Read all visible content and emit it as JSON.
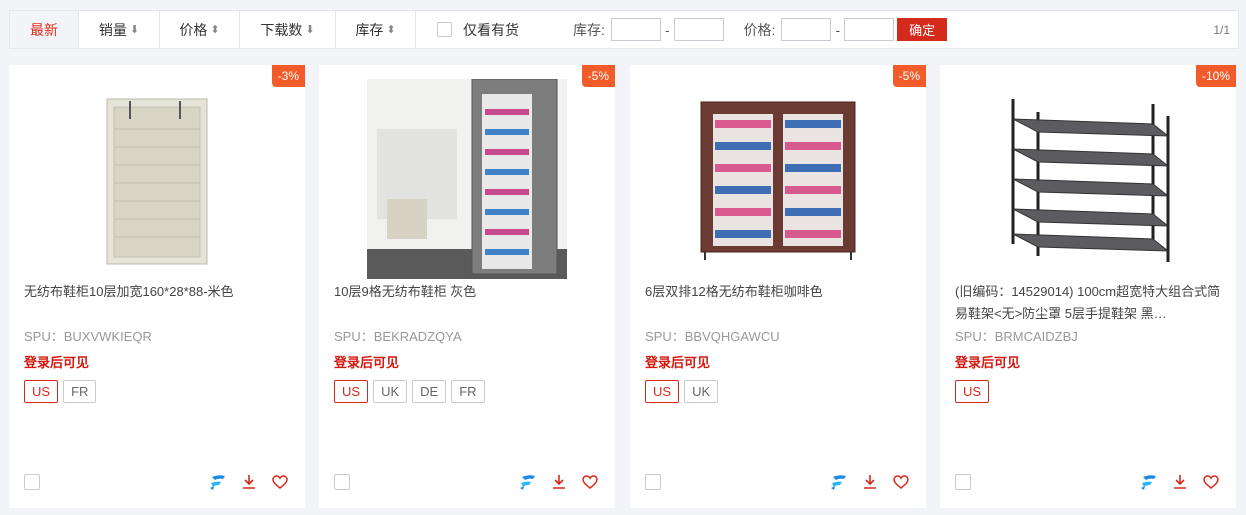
{
  "filters": {
    "sort_tabs": [
      {
        "label": "最新",
        "arrow": ""
      },
      {
        "label": "销量",
        "arrow": "⬇"
      },
      {
        "label": "价格",
        "arrow": "⬍"
      },
      {
        "label": "下载数",
        "arrow": "⬇"
      },
      {
        "label": "库存",
        "arrow": "⬍"
      }
    ],
    "in_stock_label": "仅看有货",
    "stock_label": "库存:",
    "price_label": "价格:",
    "range_dash": "-",
    "confirm_label": "确定",
    "pagination": "1/1"
  },
  "colors": {
    "accent": "#d42a1c",
    "discount": "#f25c2b",
    "brand_icon": "#1e88e5"
  },
  "products": [
    {
      "discount": "-3%",
      "title": "无纺布鞋柜10层加宽160*28*88-米色",
      "spu": "SPU：BUXVWKIEQR",
      "price_text": "登录后可见",
      "sites": [
        "US",
        "FR"
      ]
    },
    {
      "discount": "-5%",
      "title": "10层9格无纺布鞋柜 灰色",
      "spu": "SPU：BEKRADZQYA",
      "price_text": "登录后可见",
      "sites": [
        "US",
        "UK",
        "DE",
        "FR"
      ]
    },
    {
      "discount": "-5%",
      "title": "6层双排12格无纺布鞋柜咖啡色",
      "spu": "SPU：BBVQHGAWCU",
      "price_text": "登录后可见",
      "sites": [
        "US",
        "UK"
      ]
    },
    {
      "discount": "-10%",
      "title": "(旧编码：14529014) 100cm超宽特大组合式简易鞋架<无>防尘罩 5层手提鞋架 黑…",
      "spu": "SPU：BRMCAIDZBJ",
      "price_text": "登录后可见",
      "sites": [
        "US"
      ]
    }
  ]
}
